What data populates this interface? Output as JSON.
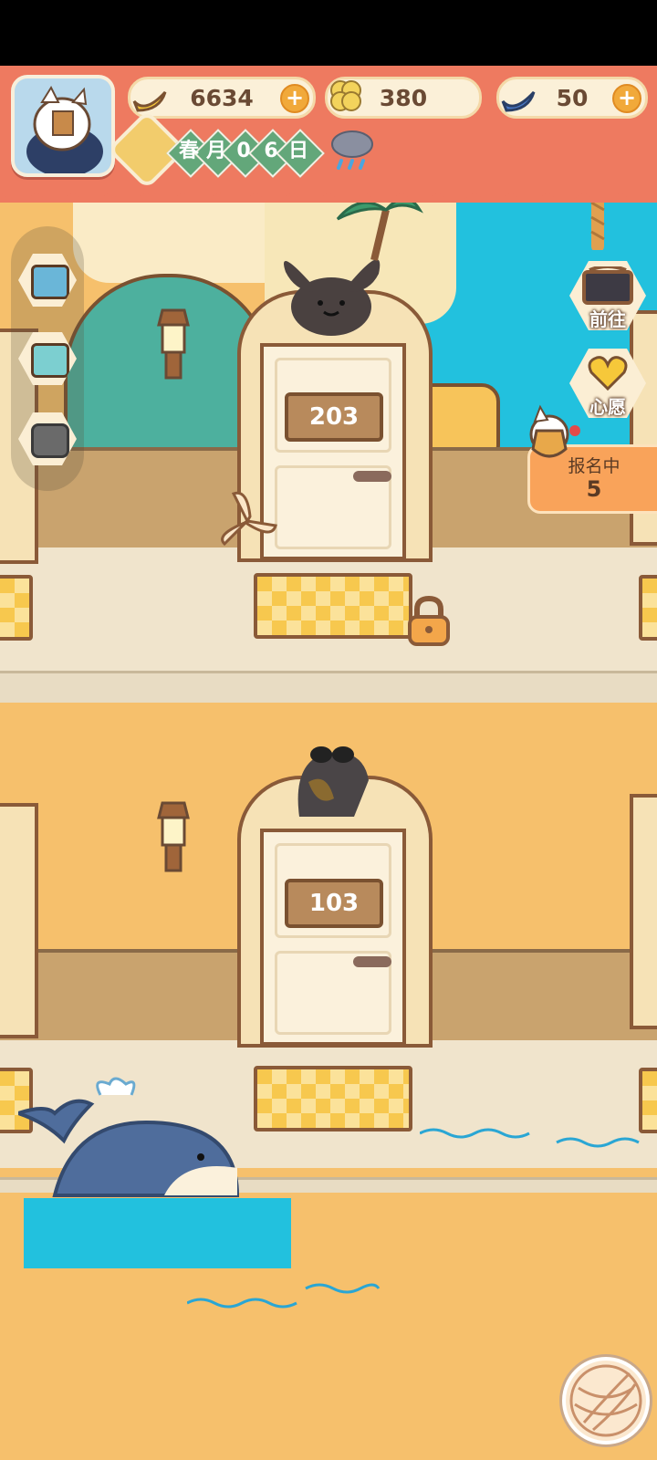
{
  "resources": {
    "banana": {
      "value": "6634",
      "icon": "banana-icon"
    },
    "clover": {
      "value": "380",
      "icon": "clover-icon"
    },
    "blue_banana": {
      "value": "50",
      "icon": "blue-banana-icon"
    },
    "plus_label": "+"
  },
  "calendar": {
    "chars": [
      "春",
      "月",
      "0",
      "6",
      "日"
    ],
    "weather_icon": "rain-cloud-icon"
  },
  "side_menu": [
    "tv-video-icon",
    "shop-icon",
    "camera-icon"
  ],
  "right_buttons": {
    "goto_label": "前往",
    "wish_label": "心愿"
  },
  "signup": {
    "title": "报名中",
    "count": "5"
  },
  "rooms": {
    "upper": "203",
    "lower": "103"
  },
  "colors": {
    "hud_red": "#ee7a60",
    "sea": "#22c1de",
    "sand": "#f6c06c",
    "door": "#fbf1dc"
  }
}
